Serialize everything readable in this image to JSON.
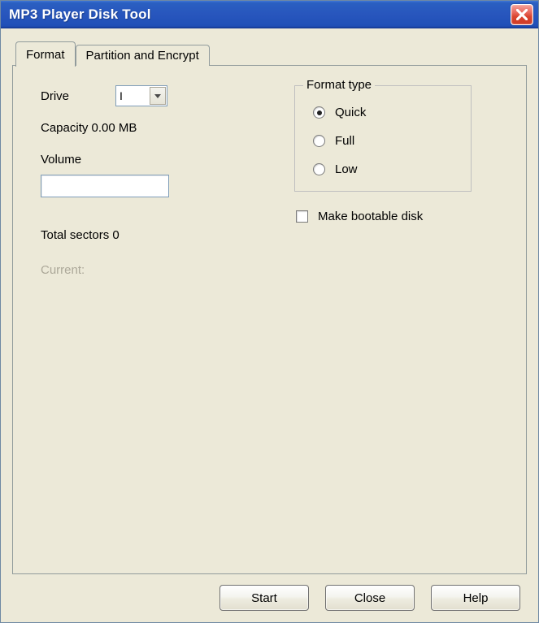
{
  "window": {
    "title": "MP3 Player Disk Tool"
  },
  "tabs": {
    "format": "Format",
    "partition": "Partition and Encrypt"
  },
  "left": {
    "drive_label": "Drive",
    "drive_value": "I",
    "capacity_line": "Capacity 0.00 MB",
    "volume_label": "Volume",
    "volume_value": "",
    "sectors_line": "Total sectors 0",
    "current_line": "Current:"
  },
  "format_type": {
    "group_label": "Format type",
    "quick": "Quick",
    "full": "Full",
    "low": "Low",
    "selected": "quick"
  },
  "bootable": {
    "label": "Make bootable disk",
    "checked": false
  },
  "buttons": {
    "start": "Start",
    "close": "Close",
    "help": "Help"
  }
}
